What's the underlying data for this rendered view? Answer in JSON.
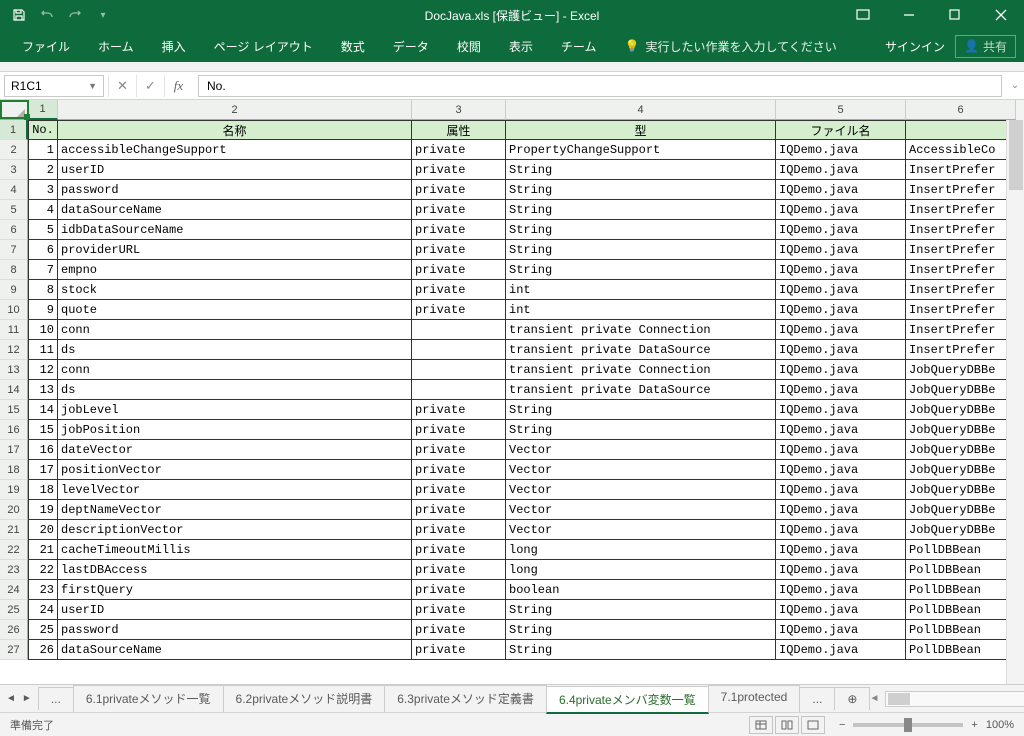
{
  "title": "DocJava.xls  [保護ビュー] - Excel",
  "qat": {
    "save": "save-icon",
    "undo": "undo-icon",
    "redo": "redo-icon"
  },
  "tabs": [
    "ファイル",
    "ホーム",
    "挿入",
    "ページ レイアウト",
    "数式",
    "データ",
    "校閲",
    "表示",
    "チーム"
  ],
  "tellme": "実行したい作業を入力してください",
  "signin": "サインイン",
  "share": "共有",
  "namebox": "R1C1",
  "formula": "No.",
  "colHeaders": [
    "1",
    "2",
    "3",
    "4",
    "5",
    "6"
  ],
  "headerRow": [
    "No.",
    "名称",
    "属性",
    "型",
    "ファイル名",
    ""
  ],
  "rows": [
    [
      1,
      "accessibleChangeSupport",
      "private",
      "PropertyChangeSupport",
      "IQDemo.java",
      "AccessibleCo"
    ],
    [
      2,
      "userID",
      "private",
      "String",
      "IQDemo.java",
      "InsertPrefer"
    ],
    [
      3,
      "password",
      "private",
      "String",
      "IQDemo.java",
      "InsertPrefer"
    ],
    [
      4,
      "dataSourceName",
      "private",
      "String",
      "IQDemo.java",
      "InsertPrefer"
    ],
    [
      5,
      "idbDataSourceName",
      "private",
      "String",
      "IQDemo.java",
      "InsertPrefer"
    ],
    [
      6,
      "providerURL",
      "private",
      "String",
      "IQDemo.java",
      "InsertPrefer"
    ],
    [
      7,
      "empno",
      "private",
      "String",
      "IQDemo.java",
      "InsertPrefer"
    ],
    [
      8,
      "stock",
      "private",
      "int",
      "IQDemo.java",
      "InsertPrefer"
    ],
    [
      9,
      "quote",
      "private",
      "int",
      "IQDemo.java",
      "InsertPrefer"
    ],
    [
      10,
      "conn",
      "",
      "transient private Connection",
      "IQDemo.java",
      "InsertPrefer"
    ],
    [
      11,
      "ds",
      "",
      "transient private DataSource",
      "IQDemo.java",
      "InsertPrefer"
    ],
    [
      12,
      "conn",
      "",
      "transient private Connection",
      "IQDemo.java",
      "JobQueryDBBe"
    ],
    [
      13,
      "ds",
      "",
      "transient private DataSource",
      "IQDemo.java",
      "JobQueryDBBe"
    ],
    [
      14,
      "jobLevel",
      "private",
      "String",
      "IQDemo.java",
      "JobQueryDBBe"
    ],
    [
      15,
      "jobPosition",
      "private",
      "String",
      "IQDemo.java",
      "JobQueryDBBe"
    ],
    [
      16,
      "dateVector",
      "private",
      "Vector",
      "IQDemo.java",
      "JobQueryDBBe"
    ],
    [
      17,
      "positionVector",
      "private",
      "Vector",
      "IQDemo.java",
      "JobQueryDBBe"
    ],
    [
      18,
      "levelVector",
      "private",
      "Vector",
      "IQDemo.java",
      "JobQueryDBBe"
    ],
    [
      19,
      "deptNameVector",
      "private",
      "Vector",
      "IQDemo.java",
      "JobQueryDBBe"
    ],
    [
      20,
      "descriptionVector",
      "private",
      "Vector",
      "IQDemo.java",
      "JobQueryDBBe"
    ],
    [
      21,
      "cacheTimeoutMillis",
      "private",
      "long",
      "IQDemo.java",
      "PollDBBean"
    ],
    [
      22,
      "lastDBAccess",
      "private",
      "long",
      "IQDemo.java",
      "PollDBBean"
    ],
    [
      23,
      "firstQuery",
      "private",
      "boolean",
      "IQDemo.java",
      "PollDBBean"
    ],
    [
      24,
      "userID",
      "private",
      "String",
      "IQDemo.java",
      "PollDBBean"
    ],
    [
      25,
      "password",
      "private",
      "String",
      "IQDemo.java",
      "PollDBBean"
    ],
    [
      26,
      "dataSourceName",
      "private",
      "String",
      "IQDemo.java",
      "PollDBBean"
    ]
  ],
  "sheetTabs": {
    "ellipsis": "...",
    "items": [
      "6.1privateメソッド一覧",
      "6.2privateメソッド説明書",
      "6.3privateメソッド定義書",
      "6.4privateメンバ変数一覧",
      "7.1protected"
    ],
    "activeIndex": 3,
    "more": "..."
  },
  "status": "準備完了",
  "zoom": "100%"
}
